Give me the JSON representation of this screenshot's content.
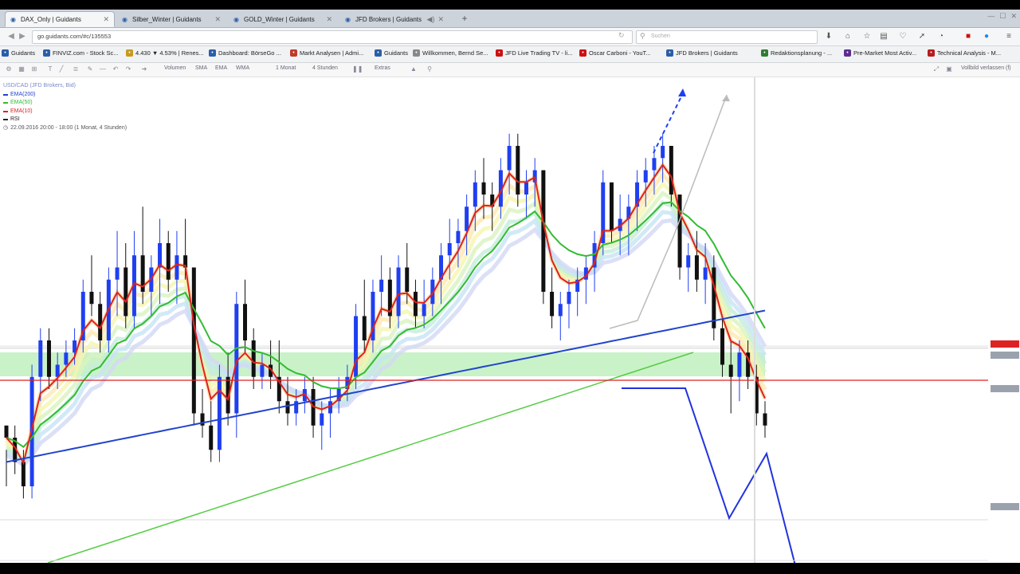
{
  "browser": {
    "tabs": [
      {
        "label": "DAX_Only | Guidants",
        "active": true
      },
      {
        "label": "Silber_Winter | Guidants",
        "active": false
      },
      {
        "label": "GOLD_Winter | Guidants",
        "active": false
      },
      {
        "label": "JFD Brokers | Guidants",
        "active": false
      }
    ],
    "url": "go.guidants.com/#c/135553",
    "search_placeholder": "Suchen"
  },
  "bookmarks": [
    {
      "label": "Guidants",
      "icon": "guidants-icon",
      "color": "#2a5ea8"
    },
    {
      "label": "FINVIZ.com - Stock Sc...",
      "icon": "finviz-icon",
      "color": "#2a5ea8"
    },
    {
      "label": "4.430 ▼ 4.53% | Renes...",
      "icon": "coin-icon",
      "color": "#c79a1e"
    },
    {
      "label": "Dashboard: BörseGo ...",
      "icon": "boersego-icon",
      "color": "#2a5ea8"
    },
    {
      "label": "Markt Analysen | Admi...",
      "icon": "markt-icon",
      "color": "#c0392b"
    },
    {
      "label": "Guidants",
      "icon": "guidants-icon",
      "color": "#2a5ea8"
    },
    {
      "label": "Willkommen, Bernd Se...",
      "icon": "bookmark-icon",
      "color": "#888888"
    },
    {
      "label": "JFD Live Trading TV - li...",
      "icon": "jfd-icon",
      "color": "#cc1111"
    },
    {
      "label": "Oscar Carboni - YouT...",
      "icon": "youtube-icon",
      "color": "#cc1111"
    },
    {
      "label": "JFD Brokers | Guidants",
      "icon": "guidants-icon",
      "color": "#2a5ea8"
    },
    {
      "label": "Redaktionsplanung - ...",
      "icon": "sheet-icon",
      "color": "#2e7d32"
    },
    {
      "label": "Pre-Market Most Activ...",
      "icon": "yahoo-icon",
      "color": "#5c2d91"
    },
    {
      "label": "Technical Analysis - M...",
      "icon": "m-icon",
      "color": "#b71c1c"
    }
  ],
  "chart_toolbar": {
    "items": [
      "Volumen",
      "SMA",
      "EMA",
      "WMA",
      "1 Monat",
      "4 Stunden",
      "Extras"
    ],
    "right_label": "Vollbild verlassen (f)"
  },
  "chart_header": {
    "symbol": "USD/CAD (JFD Brokers, Bid)",
    "indicators": [
      {
        "label": "EMA(200)",
        "color": "#2244cc"
      },
      {
        "label": "EMA(50)",
        "color": "#33bb33"
      },
      {
        "label": "EMA(10)",
        "color": "#dd2222"
      },
      {
        "label": "RSI",
        "color": "#222222"
      }
    ],
    "timestamp": "22.09.2016 20:00 - 18:00 (1 Monat, 4 Stunden)"
  },
  "chart_data": {
    "type": "candlestick",
    "candles": [
      [
        9,
        7,
        4,
        8
      ],
      [
        8,
        9,
        5,
        6
      ],
      [
        6,
        7,
        3,
        4
      ],
      [
        4,
        14,
        3,
        13
      ],
      [
        13,
        17,
        11,
        16
      ],
      [
        16,
        17,
        12,
        13
      ],
      [
        13,
        15,
        12,
        14
      ],
      [
        14,
        16,
        13,
        15
      ],
      [
        15,
        17,
        14,
        16
      ],
      [
        16,
        21,
        15,
        20
      ],
      [
        20,
        23,
        18,
        19
      ],
      [
        19,
        20,
        15,
        16
      ],
      [
        16,
        22,
        15,
        21
      ],
      [
        21,
        25,
        18,
        22
      ],
      [
        22,
        24,
        17,
        18
      ],
      [
        18,
        25,
        17,
        23
      ],
      [
        23,
        27,
        19,
        20
      ],
      [
        20,
        23,
        18,
        22
      ],
      [
        22,
        26,
        19,
        24
      ],
      [
        24,
        25,
        20,
        21
      ],
      [
        21,
        25,
        19,
        23
      ],
      [
        23,
        26,
        21,
        22
      ],
      [
        22,
        21,
        9,
        10
      ],
      [
        10,
        12,
        8,
        9
      ],
      [
        9,
        11,
        6,
        7
      ],
      [
        7,
        14,
        6,
        13
      ],
      [
        13,
        15,
        9,
        10
      ],
      [
        10,
        20,
        8,
        19
      ],
      [
        19,
        21,
        15,
        16
      ],
      [
        16,
        17,
        12,
        13
      ],
      [
        13,
        15,
        12,
        14
      ],
      [
        14,
        16,
        12,
        13
      ],
      [
        13,
        16,
        10,
        11
      ],
      [
        11,
        13,
        9,
        10
      ],
      [
        10,
        12,
        9,
        11
      ],
      [
        11,
        13,
        10,
        12
      ],
      [
        12,
        13,
        8,
        9
      ],
      [
        9,
        11,
        7,
        10
      ],
      [
        10,
        12,
        8,
        11
      ],
      [
        11,
        13,
        10,
        12
      ],
      [
        12,
        14,
        11,
        13
      ],
      [
        13,
        19,
        12,
        18
      ],
      [
        18,
        21,
        15,
        16
      ],
      [
        16,
        21,
        15,
        20
      ],
      [
        20,
        23,
        18,
        21
      ],
      [
        21,
        22,
        17,
        18
      ],
      [
        18,
        23,
        17,
        22
      ],
      [
        22,
        24,
        19,
        20
      ],
      [
        20,
        21,
        17,
        18
      ],
      [
        18,
        21,
        17,
        19
      ],
      [
        19,
        22,
        18,
        21
      ],
      [
        21,
        24,
        19,
        23
      ],
      [
        23,
        26,
        21,
        24
      ],
      [
        24,
        26,
        22,
        25
      ],
      [
        25,
        28,
        23,
        27
      ],
      [
        27,
        30,
        25,
        29
      ],
      [
        29,
        31,
        26,
        28
      ],
      [
        28,
        29,
        25,
        27
      ],
      [
        27,
        31,
        26,
        30
      ],
      [
        30,
        33,
        28,
        32
      ],
      [
        32,
        33,
        27,
        28
      ],
      [
        28,
        30,
        26,
        29
      ],
      [
        29,
        31,
        27,
        30
      ],
      [
        30,
        29,
        19,
        20
      ],
      [
        20,
        22,
        17,
        18
      ],
      [
        18,
        20,
        16,
        19
      ],
      [
        19,
        21,
        17,
        20
      ],
      [
        20,
        22,
        18,
        21
      ],
      [
        21,
        23,
        19,
        22
      ],
      [
        22,
        25,
        20,
        24
      ],
      [
        24,
        30,
        23,
        29
      ],
      [
        29,
        28,
        24,
        25
      ],
      [
        25,
        28,
        23,
        26
      ],
      [
        26,
        28,
        23,
        27
      ],
      [
        27,
        30,
        25,
        29
      ],
      [
        29,
        31,
        27,
        30
      ],
      [
        30,
        32,
        28,
        31
      ],
      [
        31,
        33,
        29,
        32
      ],
      [
        32,
        31,
        27,
        28
      ],
      [
        28,
        27,
        21,
        22
      ],
      [
        22,
        24,
        20,
        23
      ],
      [
        23,
        25,
        20,
        21
      ],
      [
        21,
        24,
        19,
        22
      ],
      [
        22,
        23,
        16,
        17
      ],
      [
        17,
        18,
        13,
        14
      ],
      [
        14,
        16,
        10,
        13
      ],
      [
        13,
        16,
        11,
        15
      ],
      [
        15,
        16,
        12,
        13
      ],
      [
        13,
        14,
        9,
        10
      ],
      [
        10,
        11,
        8,
        9
      ]
    ],
    "horizontal_line": "price line (red)",
    "ema_colors": {
      "ema200": "#2244cc",
      "ema50": "#33bb33",
      "ema10": "#dd2222"
    }
  }
}
